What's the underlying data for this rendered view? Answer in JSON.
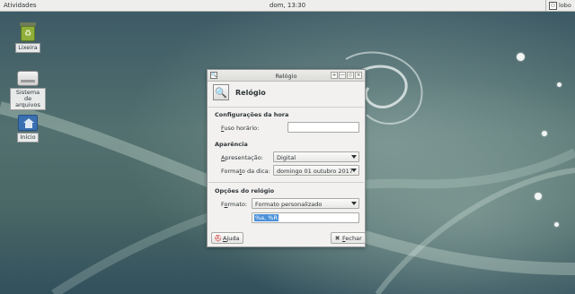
{
  "topbar": {
    "activities": "Atividades",
    "clock": "dom, 13:30",
    "user": "lobo",
    "user_icon": "user-icon"
  },
  "desktop": {
    "icons": [
      {
        "label": "Lixeira",
        "icon": "trash-icon"
      },
      {
        "label": "Sistema de arquivos",
        "icon": "drive-icon"
      },
      {
        "label": "Início",
        "icon": "home-folder-icon"
      }
    ]
  },
  "dialog": {
    "window_title": "Relógio",
    "header_title": "Relógio",
    "header_icon": "clock-settings-icon",
    "window_buttons": [
      "+",
      "—",
      "◇",
      "×"
    ],
    "sections": {
      "time": {
        "title": "Configurações da hora",
        "timezone_label_u": "F",
        "timezone_label_rest": "uso horário:",
        "timezone_value": ""
      },
      "appearance": {
        "title": "Aparência",
        "layout_label_u": "A",
        "layout_label_rest": "presentação:",
        "layout_value": "Digital",
        "tooltip_label_pre": "Forma",
        "tooltip_label_u": "t",
        "tooltip_label_post": "o da dica:",
        "tooltip_value": "domingo 01 outubro 2017"
      },
      "clock_options": {
        "title": "Opções do relógio",
        "format_label_pre": "F",
        "format_label_u": "o",
        "format_label_post": "rmato:",
        "format_value": "Formato personalizado",
        "custom_format_value": "%a, %R"
      }
    },
    "buttons": {
      "help_u": "A",
      "help_rest": "juda",
      "close_u": "F",
      "close_rest": "echar"
    }
  }
}
